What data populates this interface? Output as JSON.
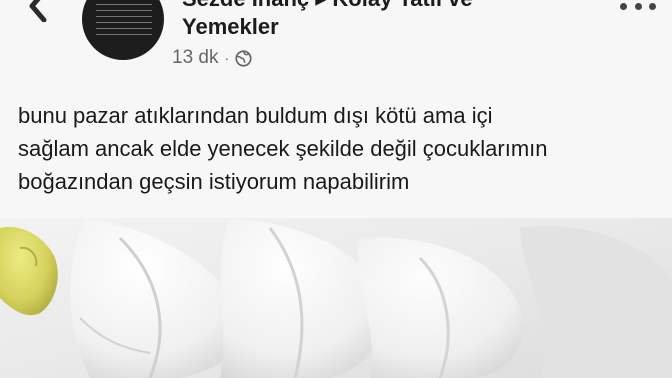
{
  "header": {
    "author": "Sezde İnanç ▸ Kolay Tatlı ve",
    "group": "Yemekler",
    "timestamp": "13 dk",
    "separator": "·"
  },
  "post": {
    "text": "bunu pazar atıklarından buldum dışı kötü ama içi\nsağlam ancak elde yenecek şekilde değil çocuklarımın\nboğazından geçsin istiyorum napabilirim"
  },
  "icons": {
    "back": "back-chevron-icon",
    "privacy": "globe-icon",
    "more": "more-options-icon"
  },
  "photo": {
    "subject": "produce photo",
    "accent_colors": [
      "#d9d866",
      "#f2f2f2",
      "#d8d8d8"
    ]
  }
}
